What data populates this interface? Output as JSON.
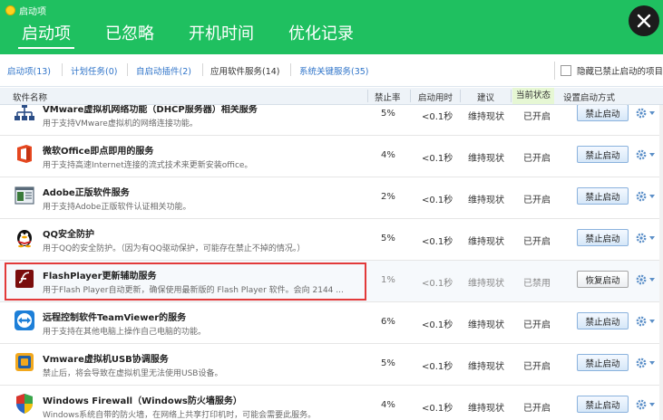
{
  "window": {
    "title": "启动项"
  },
  "main_tabs": [
    {
      "label": "启动项",
      "active": true
    },
    {
      "label": "已忽略",
      "active": false
    },
    {
      "label": "开机时间",
      "active": false
    },
    {
      "label": "优化记录",
      "active": false
    }
  ],
  "filters": {
    "items": [
      "启动项(13)",
      "计划任务(0)",
      "自启动插件(2)",
      "应用软件服务(14)",
      "系统关键服务(35)"
    ],
    "hide_disabled_label": "隐藏已禁止启动的项目"
  },
  "columns": {
    "name": "软件名称",
    "rate": "禁止率",
    "time": "启动用时",
    "advice": "建议",
    "status": "当前状态",
    "action": "设置启动方式"
  },
  "rows": [
    {
      "icon": "network-icon",
      "name": "VMware虚拟机网络功能（DHCP服务器）相关服务",
      "desc": "用于支持VMware虚拟机的网络连接功能。",
      "rate": "5%",
      "time": "<0.1秒",
      "advice": "维持现状",
      "status": "已开启",
      "action": "禁止启动",
      "selected": false
    },
    {
      "icon": "office-icon",
      "name": "微软Office即点即用的服务",
      "desc": "用于支持高速Internet连接的流式技术来更新安装office。",
      "rate": "4%",
      "time": "<0.1秒",
      "advice": "维持现状",
      "status": "已开启",
      "action": "禁止启动",
      "selected": false
    },
    {
      "icon": "adobe-window-icon",
      "name": "Adobe正版软件服务",
      "desc": "用于支持Adobe正版软件认证相关功能。",
      "rate": "2%",
      "time": "<0.1秒",
      "advice": "维持现状",
      "status": "已开启",
      "action": "禁止启动",
      "selected": false
    },
    {
      "icon": "qq-penguin-icon",
      "name": "QQ安全防护",
      "desc": "用于QQ的安全防护。（因为有QQ驱动保护，可能存在禁止不掉的情况。）",
      "rate": "5%",
      "time": "<0.1秒",
      "advice": "维持现状",
      "status": "已开启",
      "action": "禁止启动",
      "selected": false
    },
    {
      "icon": "flash-player-icon",
      "name": "FlashPlayer更新辅助服务",
      "desc": "用于Flash Player自动更新，确保使用最新版的 Flash Player 软件。会向 2144 ...",
      "rate": "1%",
      "time": "<0.1秒",
      "advice": "维持现状",
      "status": "已禁用",
      "action": "恢复启动",
      "selected": true
    },
    {
      "icon": "teamviewer-icon",
      "name": "远程控制软件TeamViewer的服务",
      "desc": "用于支持在其他电脑上操作自己电脑的功能。",
      "rate": "6%",
      "time": "<0.1秒",
      "advice": "维持现状",
      "status": "已开启",
      "action": "禁止启动",
      "selected": false
    },
    {
      "icon": "vmware-usb-icon",
      "name": "Vmware虚拟机USB协调服务",
      "desc": "禁止后，将会导致在虚拟机里无法使用USB设备。",
      "rate": "5%",
      "time": "<0.1秒",
      "advice": "维持现状",
      "status": "已开启",
      "action": "禁止启动",
      "selected": false
    },
    {
      "icon": "windows-shield-icon",
      "name": "Windows Firewall（Windows防火墙服务）",
      "desc": "Windows系统自带的防火墙，在网络上共享打印机时，可能会需要此服务。",
      "rate": "4%",
      "time": "<0.1秒",
      "advice": "维持现状",
      "status": "已开启",
      "action": "禁止启动",
      "selected": false
    }
  ]
}
